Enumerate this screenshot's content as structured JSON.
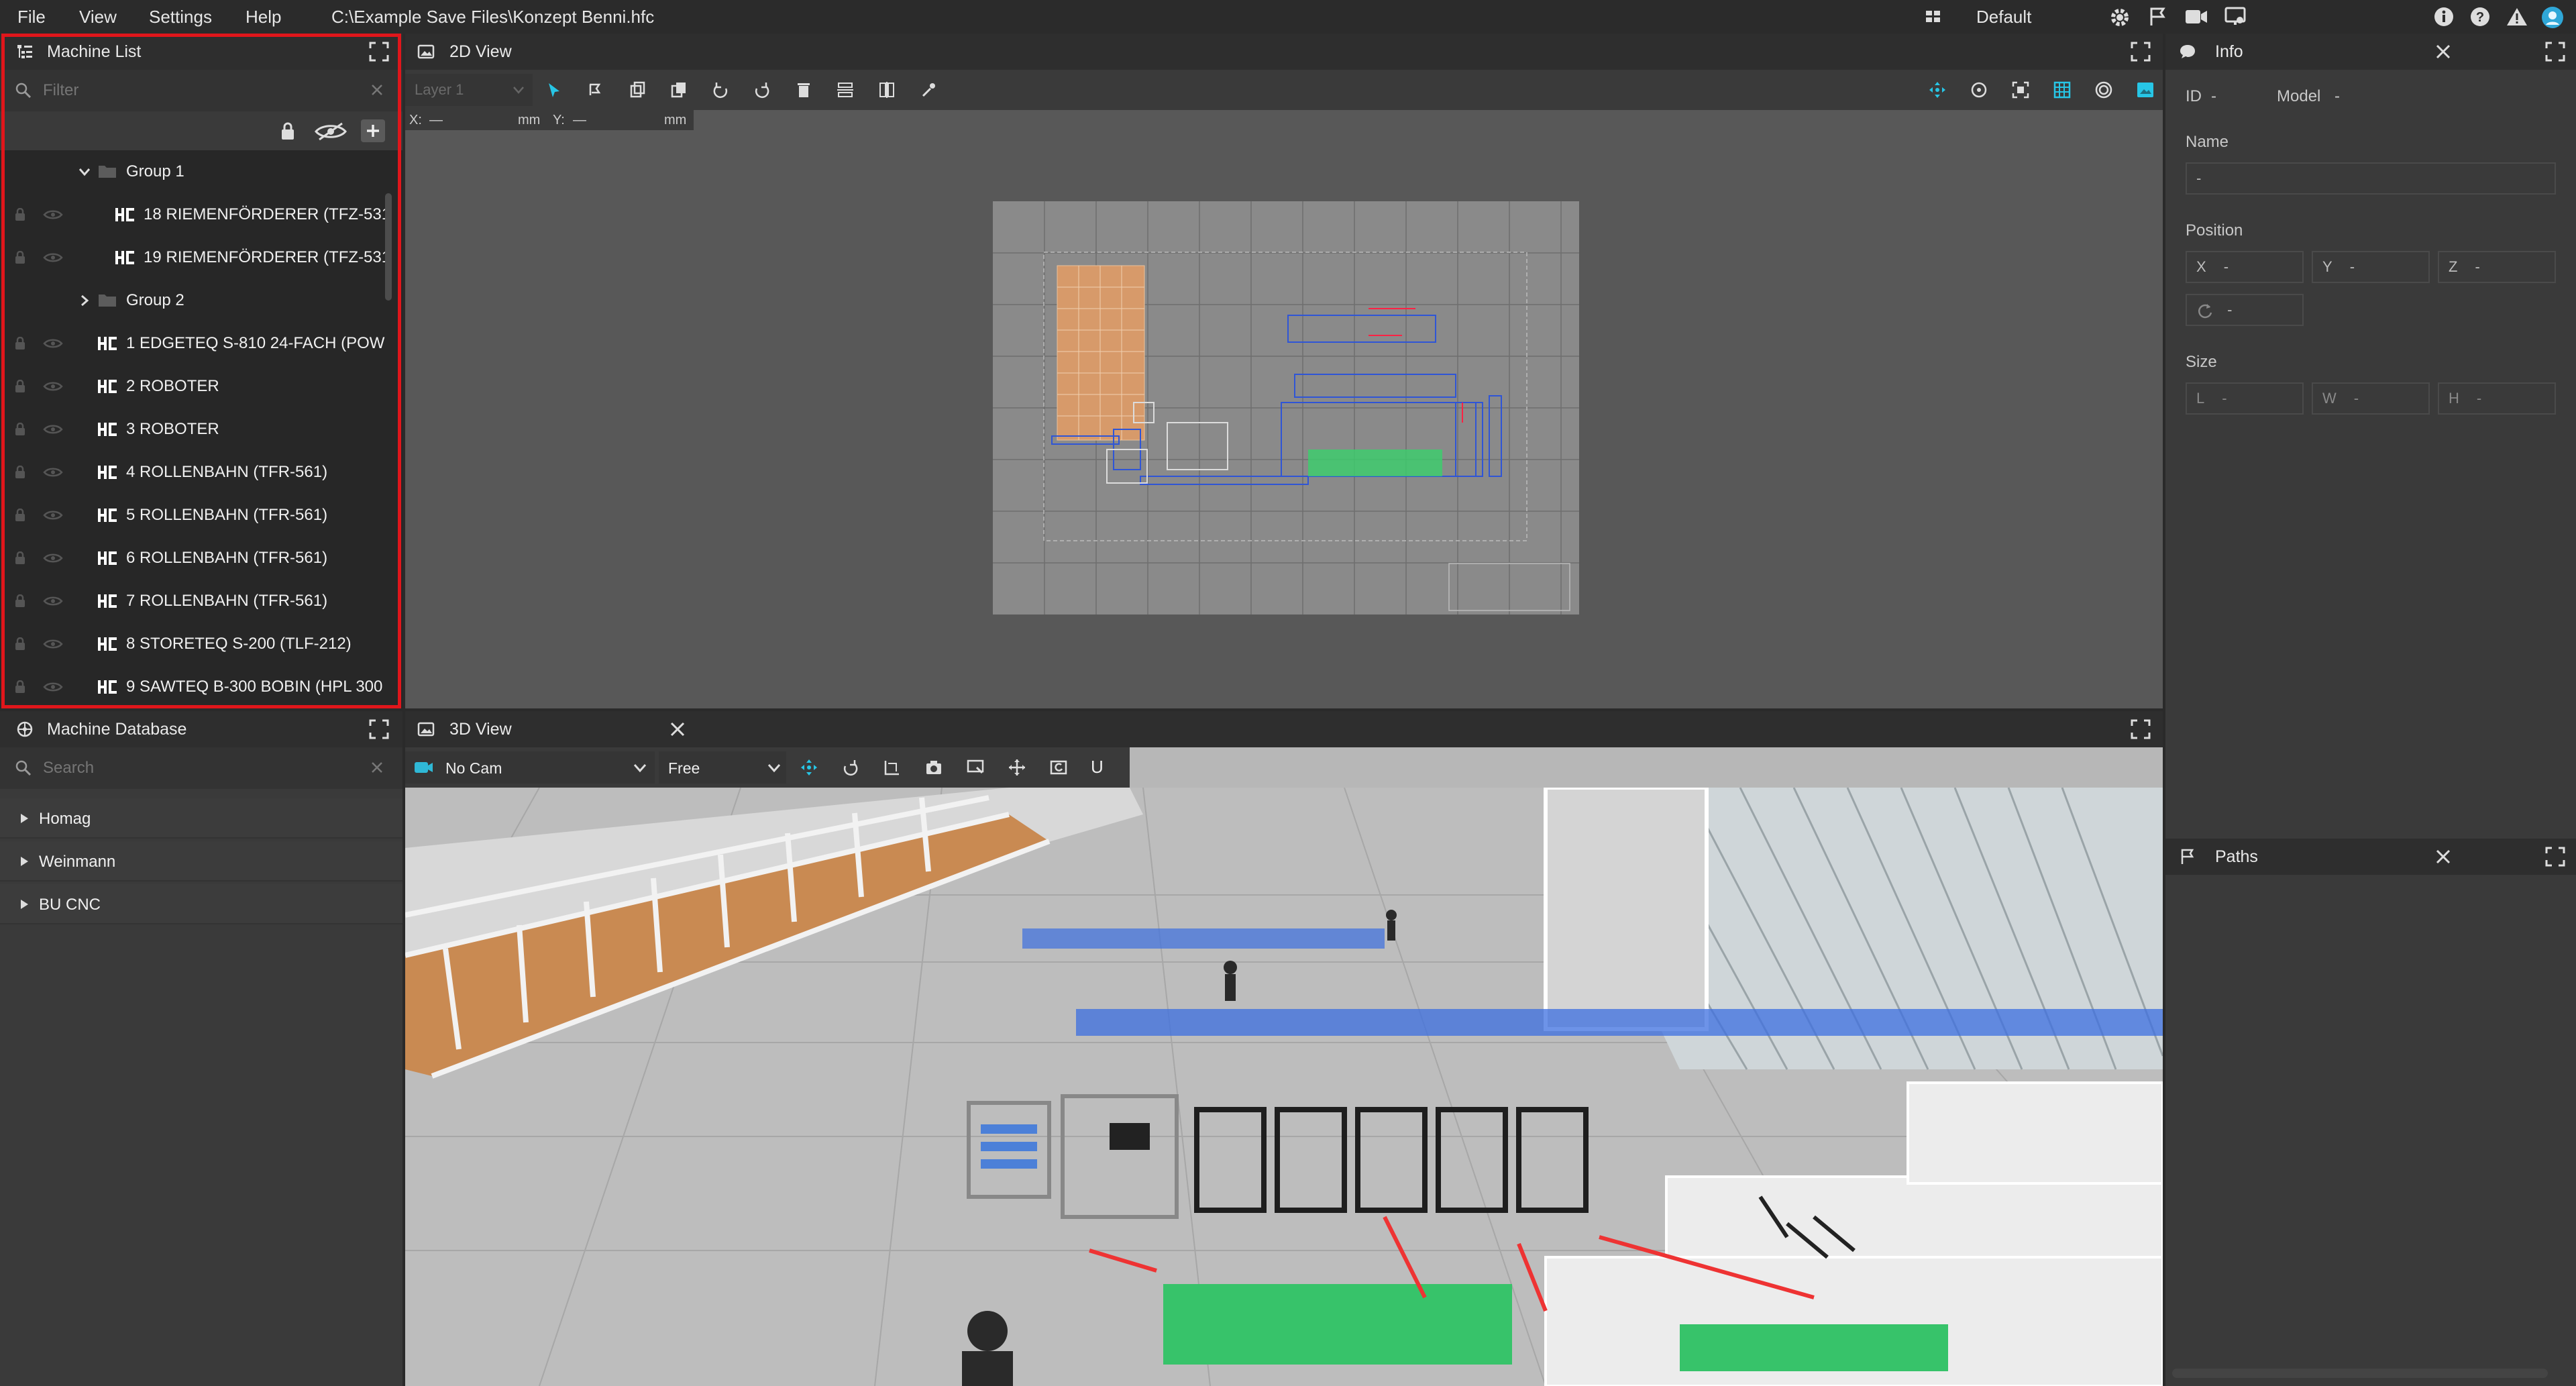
{
  "menu": {
    "file": "File",
    "view": "View",
    "settings": "Settings",
    "help": "Help",
    "path": "C:\\Example Save Files\\Konzept Benni.hfc",
    "layout": "Default"
  },
  "machine_list": {
    "title": "Machine List",
    "filter_placeholder": "Filter",
    "groups": [
      "Group 1",
      "Group 2"
    ],
    "group_items": [
      "18 RIEMENFÖRDERER (TFZ-531",
      "19 RIEMENFÖRDERER (TFZ-531"
    ],
    "items": [
      "1 EDGETEQ S-810 24-FACH (POW",
      "2 ROBOTER",
      "3 ROBOTER",
      "4 ROLLENBAHN (TFR-561)",
      "5 ROLLENBAHN (TFR-561)",
      "6 ROLLENBAHN (TFR-561)",
      "7 ROLLENBAHN (TFR-561)",
      "8 STORETEQ S-200 (TLF-212)",
      "9 SAWTEQ B-300 BOBIN (HPL 300"
    ]
  },
  "machine_db": {
    "title": "Machine Database",
    "search_placeholder": "Search",
    "items": [
      "Homag",
      "Weinmann",
      "BU CNC"
    ]
  },
  "view2d": {
    "title": "2D View",
    "layer": "Layer 1",
    "x_label": "X:",
    "x_value": "—",
    "x_unit": "mm",
    "y_label": "Y:",
    "y_value": "—",
    "y_unit": "mm"
  },
  "view3d": {
    "title": "3D View",
    "camera": "No Cam",
    "mode": "Free",
    "u_label": "U"
  },
  "info": {
    "title": "Info",
    "id_label": "ID",
    "id_value": "-",
    "model_label": "Model",
    "model_value": "-",
    "name_label": "Name",
    "name_value": "-",
    "position_label": "Position",
    "x_label": "X",
    "x_value": "-",
    "y_label": "Y",
    "y_value": "-",
    "z_label": "Z",
    "z_value": "-",
    "rot_value": "-",
    "size_label": "Size",
    "l_label": "L",
    "l_value": "-",
    "w_label": "W",
    "w_value": "-",
    "h_label": "H",
    "h_value": "-"
  },
  "paths": {
    "title": "Paths"
  },
  "colors": {
    "accent": "#27c6e6",
    "highlight_border": "#e0161b",
    "panel_bg": "#3a3a3a",
    "header_bg": "#2e2e2e"
  }
}
